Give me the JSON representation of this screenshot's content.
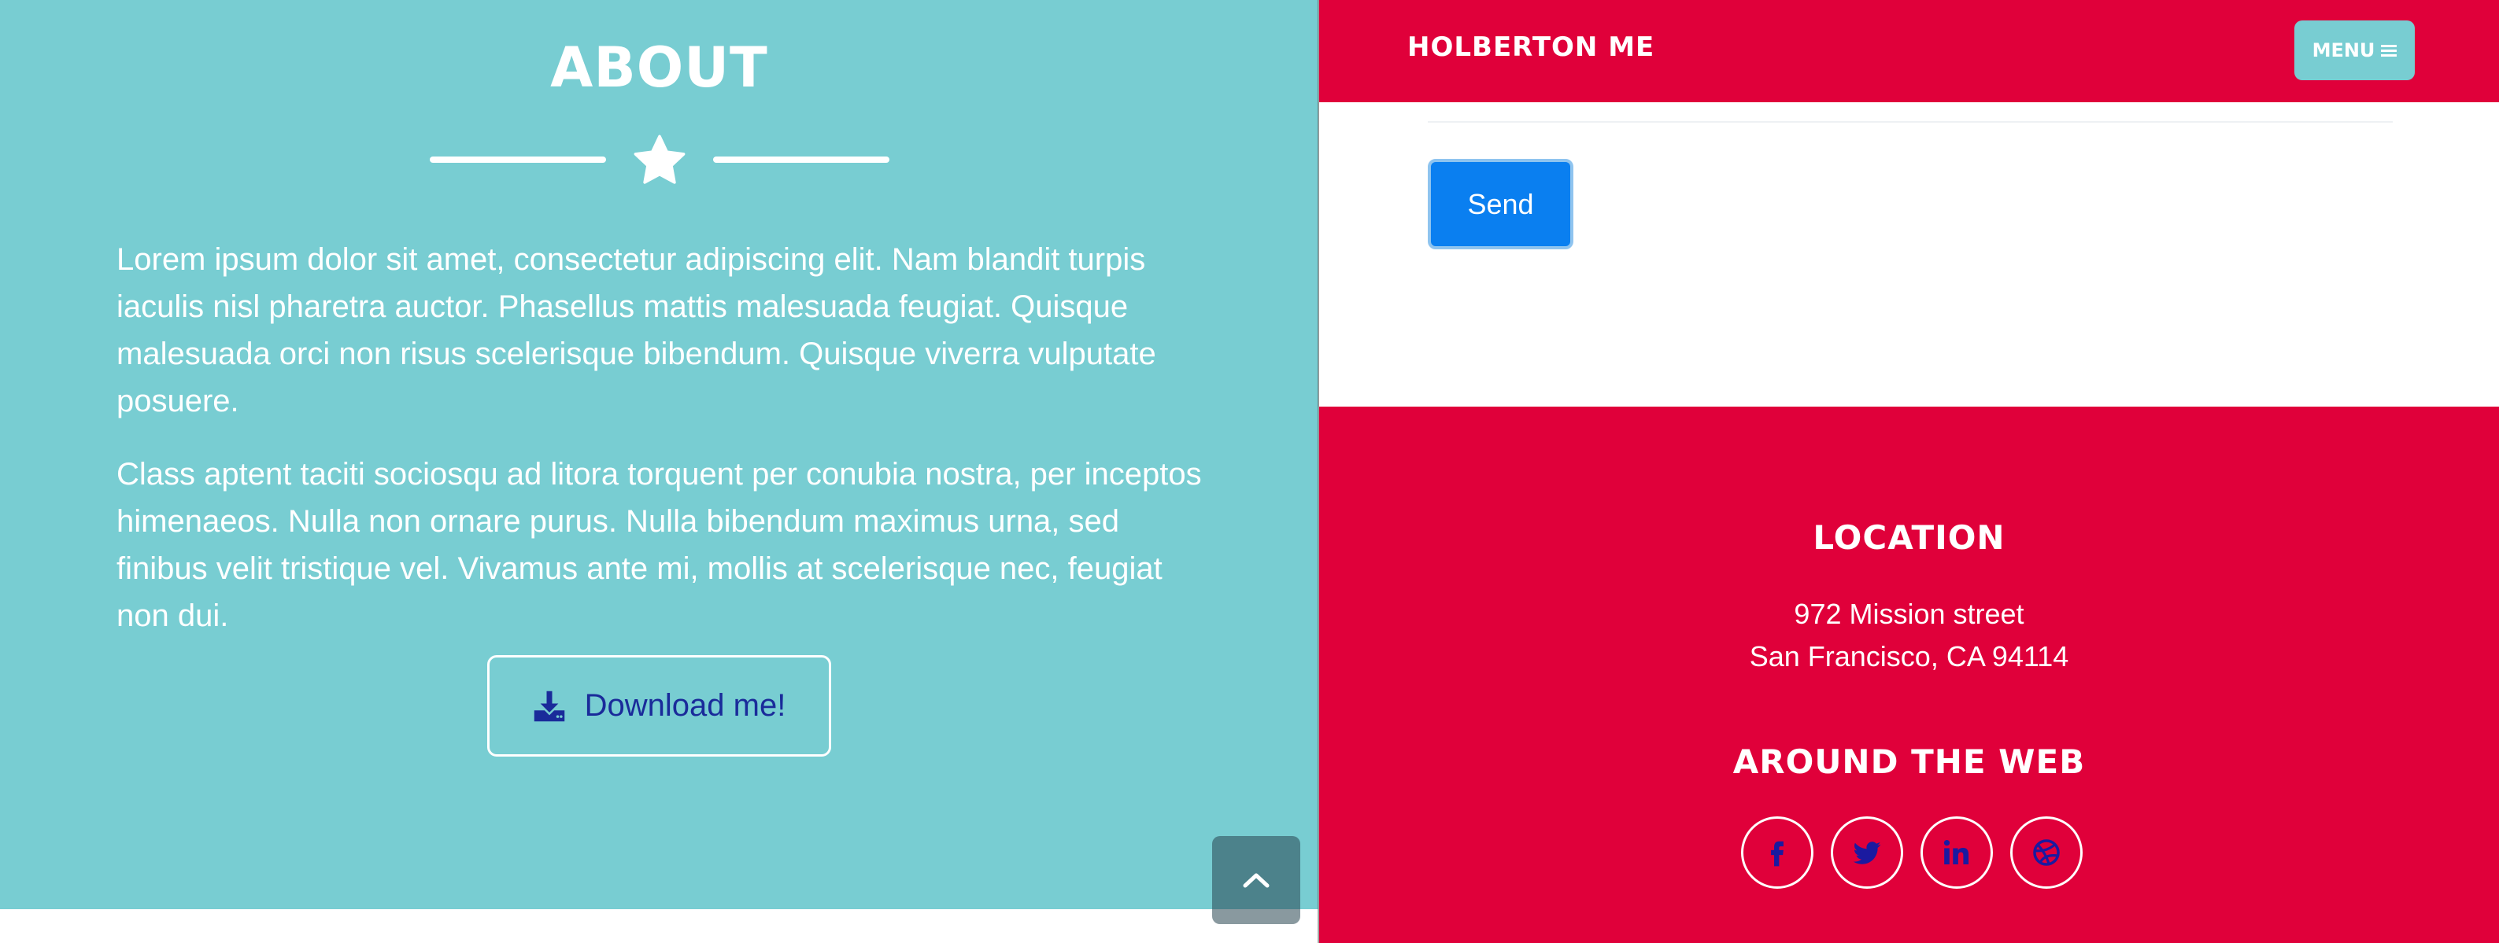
{
  "about": {
    "title": "ABOUT",
    "paragraphs": [
      "Lorem ipsum dolor sit amet, consectetur adipiscing elit. Nam blandit turpis iaculis nisl pharetra auctor. Phasellus mattis malesuada feugiat. Quisque malesuada orci non risus scelerisque bibendum. Quisque viverra vulputate posuere.",
      "Class aptent taciti sociosqu ad litora torquent per conubia nostra, per inceptos himenaeos. Nulla non ornare purus. Nulla bibendum maximus urna, sed finibus velit tristique vel. Vivamus ante mi, mollis at scelerisque nec, feugiat non dui."
    ],
    "download_label": "Download me!",
    "download_icon": "download-icon",
    "divider_icon": "star-icon"
  },
  "navbar": {
    "brand": "HOLBERTON ME",
    "menu_label": "MENU",
    "menu_icon": "hamburger-icon"
  },
  "contact": {
    "send_label": "Send"
  },
  "footer": {
    "location_title": "LOCATION",
    "address_line1": "972 Mission street",
    "address_line2": "San Francisco, CA 94114",
    "web_title": "AROUND THE WEB",
    "social_icons": [
      "facebook-icon",
      "twitter-icon",
      "linkedin-icon",
      "dribbble-icon"
    ]
  },
  "scroll_top_icon": "chevron-up-icon",
  "colors": {
    "about_bg": "#78cdd2",
    "brand_red": "#e0003a",
    "send_blue": "#0a7ff0",
    "icon_blue": "#1a2b9a"
  }
}
